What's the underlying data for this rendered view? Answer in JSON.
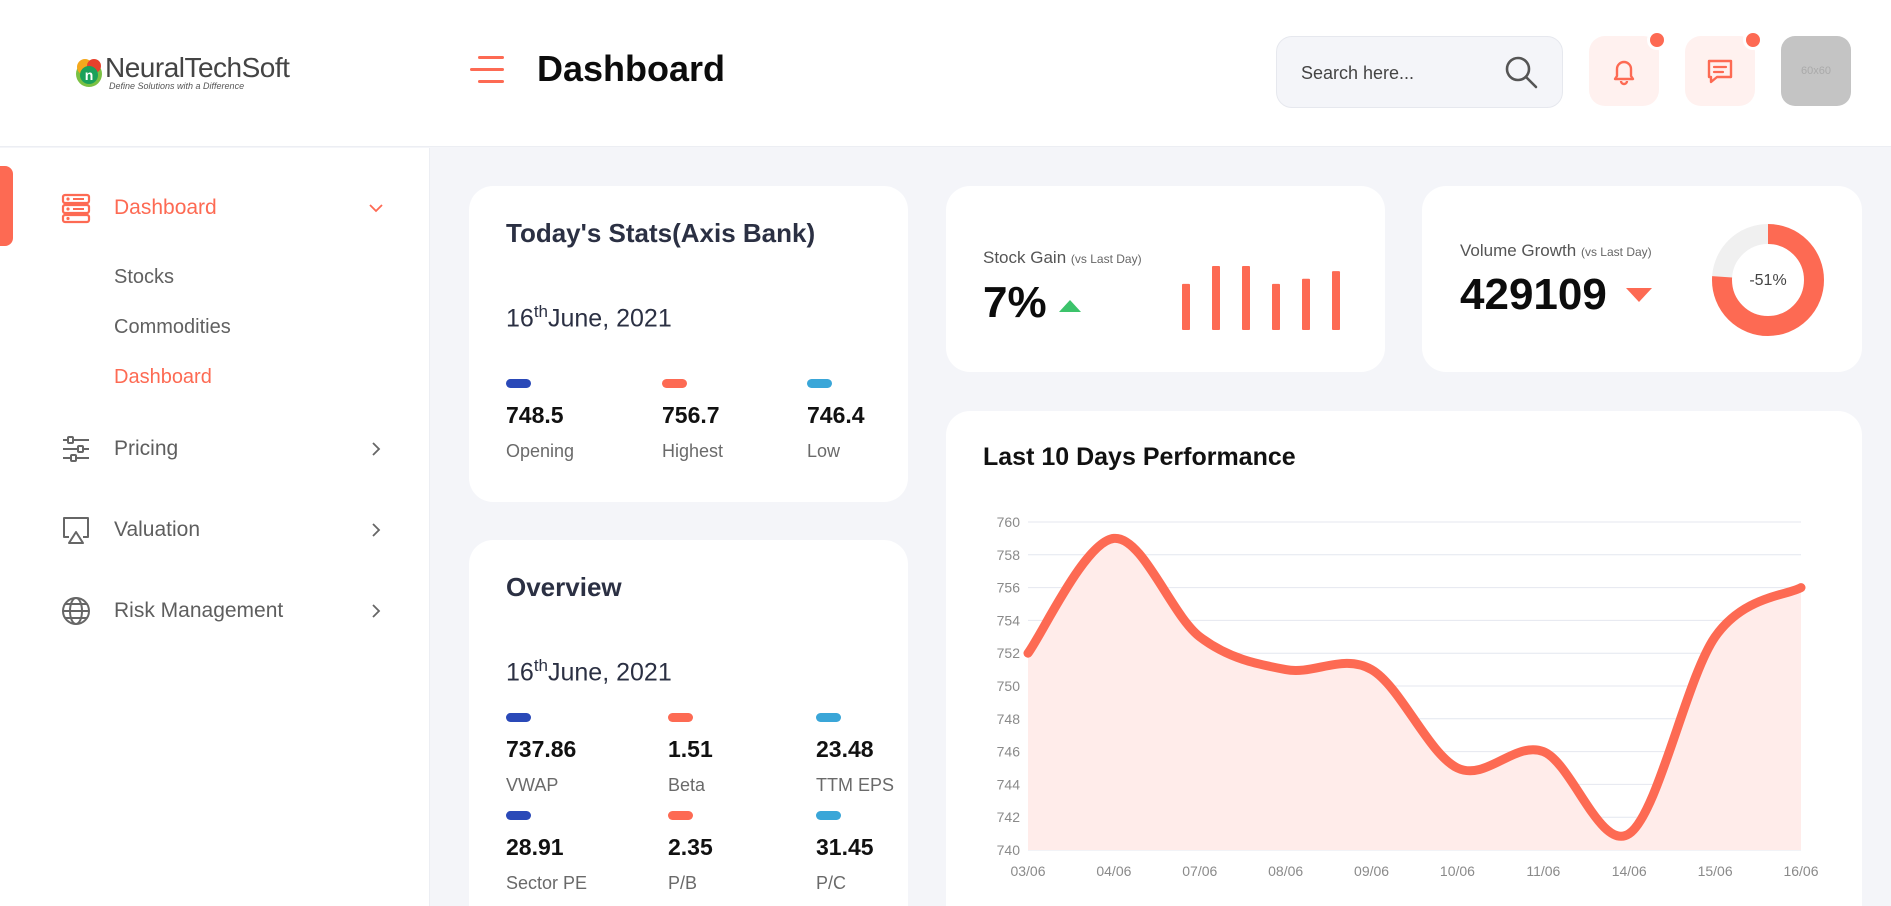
{
  "header": {
    "logo_name": "NeuralTechSoft",
    "logo_tagline": "Define Solutions with a Difference",
    "logo_letter": "n",
    "title": "Dashboard",
    "search_placeholder": "Search here...",
    "avatar_text": "60x60",
    "notifications_badge": true,
    "messages_badge": true
  },
  "sidebar": {
    "items": [
      {
        "label": "Dashboard",
        "icon": "dashboard-icon",
        "active": true,
        "expanded": true
      },
      {
        "label": "Pricing",
        "icon": "sliders-icon"
      },
      {
        "label": "Valuation",
        "icon": "airplay-icon"
      },
      {
        "label": "Risk Management",
        "icon": "globe-icon"
      }
    ],
    "sub_items": [
      {
        "label": "Stocks"
      },
      {
        "label": "Commodities"
      },
      {
        "label": "Dashboard",
        "active": true
      }
    ]
  },
  "todays_stats": {
    "title": "Today's Stats(Axis Bank)",
    "date_day": "16",
    "date_suffix": "th",
    "date_rest": "June, 2021",
    "stats": [
      {
        "value": "748.5",
        "label": "Opening",
        "color": "#2a49b8"
      },
      {
        "value": "756.7",
        "label": "Highest",
        "color": "#fd6a53"
      },
      {
        "value": "746.4",
        "label": "Low",
        "color": "#3aa6d8"
      }
    ]
  },
  "overview": {
    "title": "Overview",
    "date_day": "16",
    "date_suffix": "th",
    "date_rest": "June, 2021",
    "stats": [
      {
        "value": "737.86",
        "label": "VWAP",
        "color": "#2a49b8"
      },
      {
        "value": "1.51",
        "label": "Beta",
        "color": "#fd6a53"
      },
      {
        "value": "23.48",
        "label": "TTM EPS",
        "color": "#3aa6d8"
      },
      {
        "value": "28.91",
        "label": "Sector PE",
        "color": "#2a49b8"
      },
      {
        "value": "2.35",
        "label": "P/B",
        "color": "#fd6a53"
      },
      {
        "value": "31.45",
        "label": "P/C",
        "color": "#3aa6d8"
      }
    ]
  },
  "stock_gain": {
    "label": "Stock Gain",
    "sub": "(vs Last Day)",
    "value": "7%",
    "trend": "up",
    "trend_color": "#3cc36b",
    "bars": [
      0.72,
      1.0,
      1.0,
      0.72,
      0.8,
      0.92
    ]
  },
  "volume_growth": {
    "label": "Volume Growth",
    "sub": "(vs Last Day)",
    "value": "429109",
    "trend": "down",
    "donut_text": "-51%",
    "donut_fraction": 0.76
  },
  "colors": {
    "accent": "#fd6a53",
    "accent_soft": "#fff1ef",
    "background": "#f4f5f9"
  },
  "chart_data": {
    "type": "area",
    "title": "Last 10 Days Performance",
    "categories": [
      "03/06",
      "04/06",
      "07/06",
      "08/06",
      "09/06",
      "10/06",
      "11/06",
      "14/06",
      "15/06",
      "16/06"
    ],
    "values": [
      752,
      759,
      753,
      751,
      751,
      745,
      746,
      741,
      753,
      756
    ],
    "y_ticks": [
      740,
      742,
      744,
      746,
      748,
      750,
      752,
      754,
      756,
      758,
      760
    ],
    "ylim": [
      740,
      760
    ],
    "grid": true,
    "line_color": "#fd6a53",
    "fill_color": "#ffecea"
  }
}
